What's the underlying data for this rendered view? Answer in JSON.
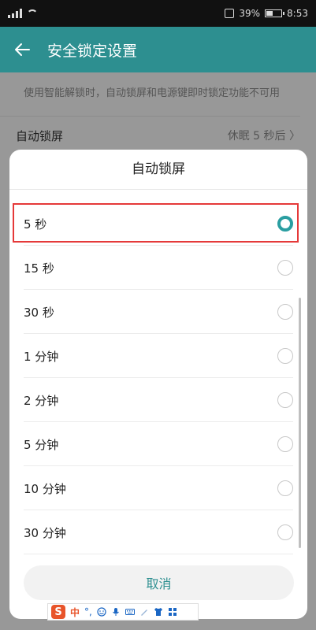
{
  "status_bar": {
    "battery_text": "39%",
    "time": "8:53"
  },
  "app_bar": {
    "title": "安全锁定设置"
  },
  "background": {
    "description": "使用智能解锁时，自动锁屏和电源键即时锁定功能不可用",
    "row_label": "自动锁屏",
    "row_value": "休眠 5 秒后 〉"
  },
  "dialog": {
    "title": "自动锁屏",
    "options": [
      {
        "label": "5 秒",
        "selected": true
      },
      {
        "label": "15 秒",
        "selected": false
      },
      {
        "label": "30 秒",
        "selected": false
      },
      {
        "label": "1 分钟",
        "selected": false
      },
      {
        "label": "2 分钟",
        "selected": false
      },
      {
        "label": "5 分钟",
        "selected": false
      },
      {
        "label": "10 分钟",
        "selected": false
      },
      {
        "label": "30 分钟",
        "selected": false
      }
    ],
    "cancel_label": "取消"
  },
  "ime": {
    "logo": "S",
    "lang": "中",
    "punct": "°,"
  },
  "colors": {
    "accent": "#2d8f90",
    "highlight_border": "#e53939"
  }
}
